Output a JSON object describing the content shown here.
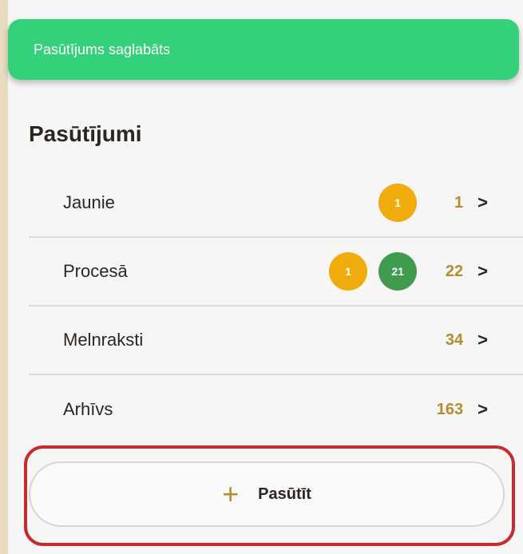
{
  "toast": {
    "message": "Pasūtījums saglabāts",
    "color": "#34d17a"
  },
  "orders": {
    "title": "Pasūtījumi",
    "rows": [
      {
        "label": "Jaunie",
        "badges": [
          {
            "value": "1",
            "color": "#efac0c"
          }
        ],
        "count": "1"
      },
      {
        "label": "Procesā",
        "badges": [
          {
            "value": "1",
            "color": "#efac0c"
          },
          {
            "value": "21",
            "color": "#3f9c4f"
          }
        ],
        "count": "22"
      },
      {
        "label": "Melnraksti",
        "badges": [],
        "count": "34"
      },
      {
        "label": "Arhīvs",
        "badges": [],
        "count": "163"
      }
    ]
  },
  "order_button": {
    "label": "Pasūtīt",
    "icon": "plus-icon"
  },
  "chevron": ">"
}
